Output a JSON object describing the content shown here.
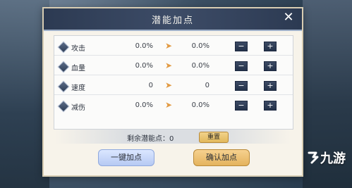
{
  "dialog": {
    "title": "潜能加点",
    "close_glyph": "✕"
  },
  "stats": [
    {
      "label": "攻击",
      "current": "0.0%",
      "next": "0.0%"
    },
    {
      "label": "血量",
      "current": "0.0%",
      "next": "0.0%"
    },
    {
      "label": "速度",
      "current": "0",
      "next": "0"
    },
    {
      "label": "减伤",
      "current": "0.0%",
      "next": "0.0%"
    }
  ],
  "controls": {
    "arrow": "➤",
    "minus": "−",
    "plus": "+"
  },
  "remaining": {
    "label": "剩余潜能点：0",
    "reset": "重置"
  },
  "buttons": {
    "one_click": "一键加点",
    "confirm": "确认加点"
  },
  "watermark": {
    "text": "九游"
  },
  "colors": {
    "title_bar": "#2c3a52",
    "dialog_bg": "#f7f3ea",
    "arrow": "#e29a42",
    "confirm": "#e4b35d",
    "one_click": "#b6c9f3"
  }
}
